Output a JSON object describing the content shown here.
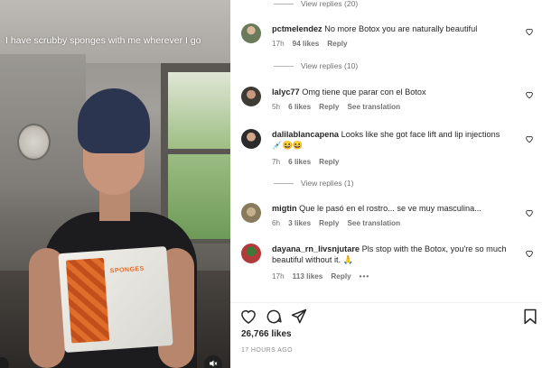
{
  "video": {
    "caption": "I have scrubby sponges with me wherever I go",
    "package_label": "SPONGES",
    "mute_icon": "speaker-muted-icon"
  },
  "top_view_replies": "View replies (20)",
  "comments": [
    {
      "username": "pctmelendez",
      "text": "No more Botox you are naturally beautiful",
      "time": "17h",
      "likes": "94 likes",
      "reply": "Reply",
      "avatar_color": "#6b7a5a",
      "view_replies": "View replies (10)"
    },
    {
      "username": "lalyc77",
      "text": "Omg tiene que parar con el Botox",
      "time": "5h",
      "likes": "6 likes",
      "reply": "Reply",
      "translate": "See translation",
      "avatar_color": "#3e3a34"
    },
    {
      "username": "dalilablancapena",
      "text": "Looks like she got face lift and lip injections",
      "emoji": "💉😆😆",
      "time": "7h",
      "likes": "6 likes",
      "reply": "Reply",
      "avatar_color": "#2b2b2b",
      "view_replies": "View replies (1)"
    },
    {
      "username": "migtin",
      "text": "Que le pasó en el rostro... se ve muy masculina...",
      "time": "6h",
      "likes": "3 likes",
      "reply": "Reply",
      "translate": "See translation",
      "avatar_color": "#8a7a5c"
    },
    {
      "username": "dayana_rn_livsnjutare",
      "text": "Pls stop with the Botox, you're so much beautiful without it. 🙏",
      "time": "17h",
      "likes": "113 likes",
      "reply": "Reply",
      "more": "•••",
      "avatar_color": "#b23a3a"
    }
  ],
  "actions": {
    "like_icon": "heart-icon",
    "comment_icon": "comment-bubble-icon",
    "share_icon": "paper-plane-icon",
    "save_icon": "bookmark-icon"
  },
  "likes_count": "26,766 likes",
  "posted": "17 HOURS AGO"
}
